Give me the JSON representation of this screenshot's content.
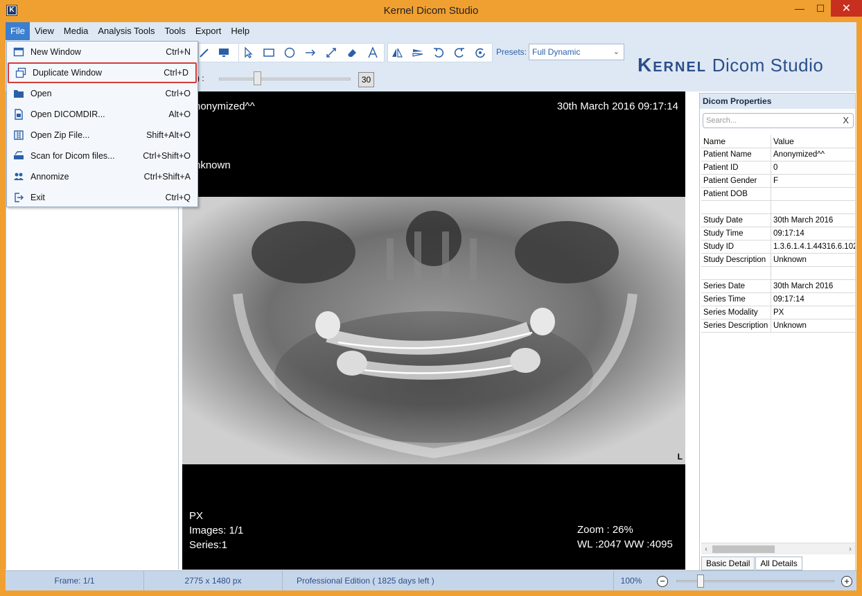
{
  "window": {
    "title": "Kernel Dicom Studio",
    "icon_letter": "K",
    "minimize": "—",
    "maximize": "☐",
    "close": "✕"
  },
  "menubar": [
    "File",
    "View",
    "Media",
    "Analysis Tools",
    "Tools",
    "Export",
    "Help"
  ],
  "toolbar": {
    "presets_label": "Presets:",
    "presets_value": "Full Dynamic",
    "fps_label": "S) :",
    "fps_value": "30",
    "brand_main": "Kernel",
    "brand_rest": " Dicom Studio"
  },
  "file_menu": [
    {
      "label": "New Window",
      "shortcut": "Ctrl+N",
      "icon": "window-icon"
    },
    {
      "label": "Duplicate Window",
      "shortcut": "Ctrl+D",
      "icon": "duplicate-window-icon",
      "highlighted": true
    },
    {
      "label": "Open",
      "shortcut": "Ctrl+O",
      "icon": "folder-icon"
    },
    {
      "label": "Open DICOMDIR...",
      "shortcut": "Alt+O",
      "icon": "document-icon"
    },
    {
      "label": "Open Zip File...",
      "shortcut": "Shift+Alt+O",
      "icon": "zip-icon"
    },
    {
      "label": "Scan for Dicom files...",
      "shortcut": "Ctrl+Shift+O",
      "icon": "scanner-icon"
    },
    {
      "label": "Annomize",
      "shortcut": "Ctrl+Shift+A",
      "icon": "users-icon"
    },
    {
      "label": "Exit",
      "shortcut": "Ctrl+Q",
      "icon": "exit-icon"
    }
  ],
  "viewer": {
    "top_left_name": "nonymized^^",
    "top_left_gender": "nknown",
    "top_right_datetime": "30th March 2016 09:17:14",
    "orientation": "L",
    "bottom_left": [
      "PX",
      "Images: 1/1",
      "Series:1"
    ],
    "zoom": "Zoom : 26%",
    "window_level": "WL :2047  WW :4095"
  },
  "properties": {
    "title": "Dicom Properties",
    "search_placeholder": "Search...",
    "search_clear": "X",
    "columns": [
      "Name",
      "Value"
    ],
    "rows": [
      [
        "Patient Name",
        "Anonymized^^"
      ],
      [
        "Patient ID",
        "0"
      ],
      [
        "Patient Gender",
        "F"
      ],
      [
        "Patient DOB",
        ""
      ],
      [
        "",
        ""
      ],
      [
        "Study Date",
        "30th March 2016"
      ],
      [
        "Study Time",
        "09:17:14"
      ],
      [
        "Study ID",
        "1.3.6.1.4.1.44316.6.102"
      ],
      [
        "Study Description",
        "Unknown"
      ],
      [
        "",
        ""
      ],
      [
        "Series Date",
        "30th March 2016"
      ],
      [
        "Series Time",
        "09:17:14"
      ],
      [
        "Series Modality",
        "PX"
      ],
      [
        "Series Description",
        "Unknown"
      ]
    ],
    "tabs": [
      "Basic Detail",
      "All Details"
    ]
  },
  "statusbar": {
    "frame": "Frame: 1/1",
    "dimensions": "2775 x 1480 px",
    "edition": "Professional Edition ( 1825 days left )",
    "zoom": "100%",
    "zoom_minus": "−",
    "zoom_plus": "+"
  },
  "colors": {
    "title_bar": "#f0a030",
    "menu_active": "#3c7fce",
    "accent": "#2b5fa8",
    "highlight_border": "#d43a3a"
  }
}
